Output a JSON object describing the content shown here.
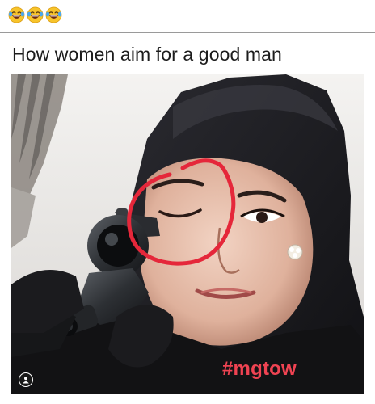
{
  "caption": {
    "text": "How women aim for a good man"
  },
  "overlay": {
    "hashtag": "#mgtow",
    "hashtag_color": "#ef4352",
    "circle_color": "#e5273a"
  },
  "reactions": [
    {
      "icon": "laughing-tears-emoji"
    },
    {
      "icon": "laughing-tears-emoji"
    },
    {
      "icon": "laughing-tears-emoji"
    }
  ],
  "photo": {
    "subject": "woman-aiming-scoped-rifle-with-one-eye-closed"
  }
}
